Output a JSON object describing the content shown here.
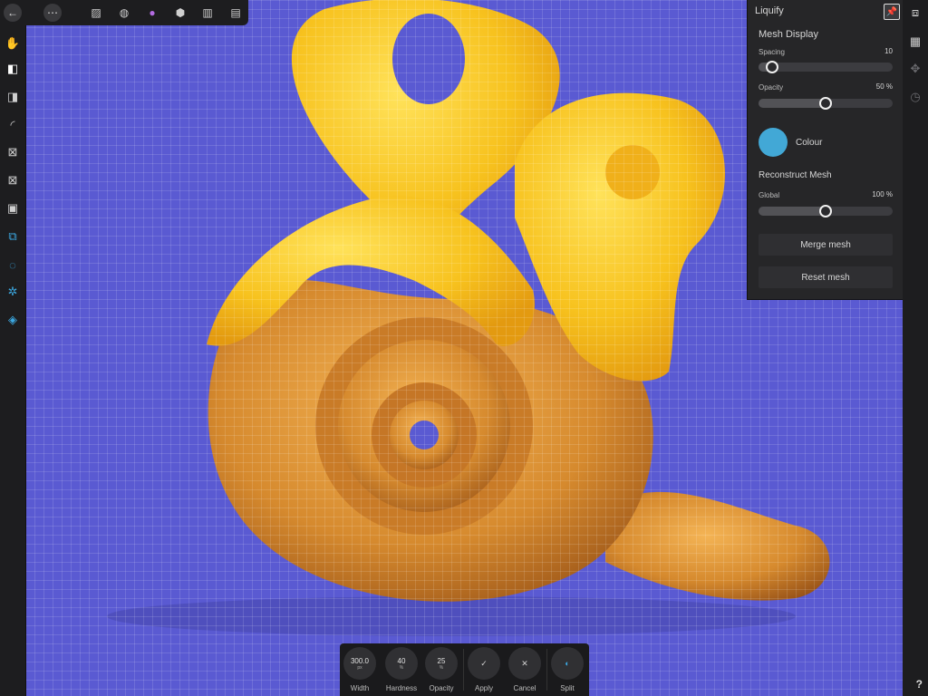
{
  "panel": {
    "title": "Liquify",
    "mesh_display_heading": "Mesh Display",
    "spacing_label": "Spacing",
    "spacing_value": "10",
    "spacing_fraction": 0.1,
    "opacity_label": "Opacity",
    "opacity_value": "50 %",
    "opacity_fraction": 0.5,
    "colour_label": "Colour",
    "colour_hex": "#42a8d6",
    "reconstruct_heading": "Reconstruct Mesh",
    "global_label": "Global",
    "global_value": "100 %",
    "global_fraction": 0.5,
    "merge_button": "Merge mesh",
    "reset_button": "Reset mesh"
  },
  "context_bar": {
    "width_value": "300.0",
    "width_unit": "px",
    "width_label": "Width",
    "hardness_value": "40",
    "hardness_unit": "%",
    "hardness_label": "Hardness",
    "opacity_value": "25",
    "opacity_unit": "%",
    "opacity_label": "Opacity",
    "apply_label": "Apply",
    "cancel_label": "Cancel",
    "split_label": "Split"
  },
  "help_label": "?",
  "colors": {
    "background": "#5a5ad2",
    "cheese": "#f7c21e",
    "pretzel": "#d68a2e",
    "accent_blue": "#3ba7e0"
  },
  "icons": {
    "top_bar": [
      "back-icon",
      "more-icon",
      "designer-persona-icon",
      "liquify-persona-icon",
      "pixel-persona-icon",
      "export-persona-icon",
      "tone-mapping-icon",
      "develop-persona-icon"
    ],
    "left_tools": [
      "hand-icon",
      "selection-brush-icon",
      "flood-select-icon",
      "freehand-select-icon",
      "mesh-clone-icon",
      "mesh-pin-icon",
      "mesh-freeze-icon",
      "push-forward-icon",
      "twirl-icon",
      "pinch-icon",
      "turbulence-icon"
    ],
    "right_strip": [
      "studio-icon",
      "mesh-icon",
      "pin-icon",
      "clock-icon"
    ]
  }
}
